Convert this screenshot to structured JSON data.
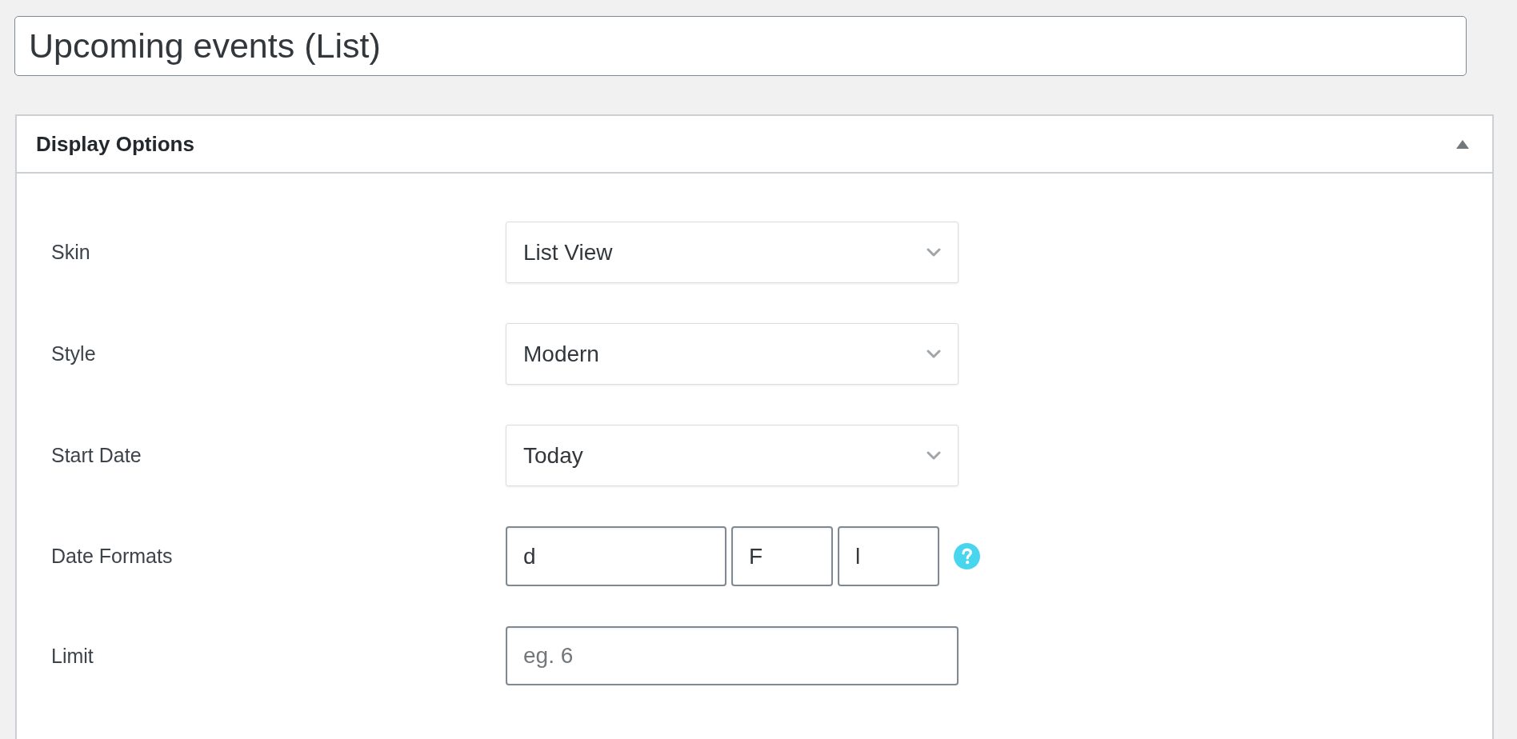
{
  "title_field": {
    "value": "Upcoming events (List)"
  },
  "panel": {
    "title": "Display Options",
    "expanded": true
  },
  "fields": [
    {
      "kind": "select",
      "label": "Skin",
      "value": "List View"
    },
    {
      "kind": "select",
      "label": "Style",
      "value": "Modern"
    },
    {
      "kind": "select",
      "label": "Start Date",
      "value": "Today"
    },
    {
      "kind": "multi",
      "label": "Date Formats",
      "values": [
        "d",
        "F",
        "l"
      ],
      "help": true
    },
    {
      "kind": "text",
      "label": "Limit",
      "placeholder": "eg. 6"
    }
  ]
}
